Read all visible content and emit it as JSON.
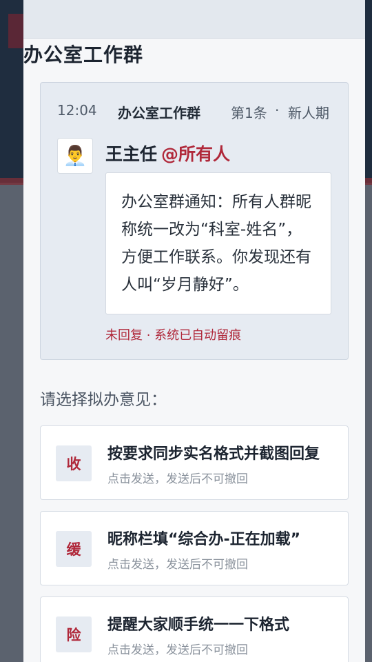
{
  "panel": {
    "title": "办公室工作群"
  },
  "message": {
    "time": "12:04",
    "group": "办公室工作群",
    "sequence": "第1条",
    "separator": "·",
    "period": "新人期",
    "avatar_icon": "office-worker-emoji",
    "avatar_glyph": "👨‍💼",
    "sender": "王主任",
    "mention": "@所有人",
    "body": "办公室群通知：所有人群昵称统一改为“科室-姓名”，方便工作联系。你发现还有人叫“岁月静好”。",
    "status": "未回复 · 系统已自动留痕"
  },
  "prompt": "请选择拟办意见：",
  "options": [
    {
      "badge": "收",
      "title": "按要求同步实名格式并截图回复",
      "subtitle": "点击发送，发送后不可撤回"
    },
    {
      "badge": "缓",
      "title": "昵称栏填“综合办-正在加载”",
      "subtitle": "点击发送，发送后不可撤回"
    },
    {
      "badge": "险",
      "title": "提醒大家顺手统一一下格式",
      "subtitle": "点击发送，发送后不可撤回"
    }
  ],
  "colors": {
    "accent_red": "#b0283a",
    "card_bg": "#e6ebf2",
    "panel_bg": "#f6f7f9"
  }
}
